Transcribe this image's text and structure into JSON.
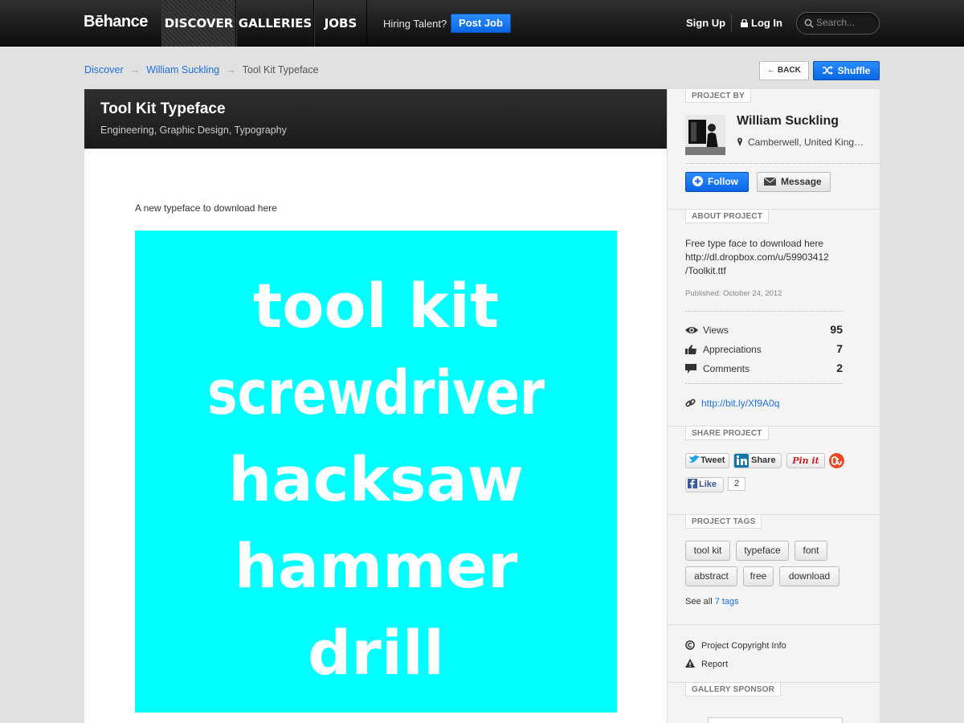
{
  "nav": {
    "logo": "Bēhance",
    "tabs": [
      "DISCOVER",
      "GALLERIES",
      "JOBS"
    ],
    "hiring_label": "Hiring Talent?",
    "post_job_label": "Post Job",
    "signup_label": "Sign Up",
    "login_label": "Log In",
    "search_placeholder": "Search..."
  },
  "breadcrumb": {
    "items": [
      "Discover",
      "William Suckling",
      "Tool Kit Typeface"
    ],
    "separator": "→"
  },
  "actions": {
    "back_label": "← BACK",
    "shuffle_label": "Shuffle"
  },
  "project": {
    "title": "Tool Kit Typeface",
    "fields": "Engineering, Graphic Design, Typography",
    "intro": "A new typeface to download here",
    "artwork_words": [
      "tool kit",
      "screwdriver",
      "hacksaw",
      "hammer",
      "drill"
    ],
    "artwork_bg": "#00ffff"
  },
  "sidebar": {
    "project_by_label": "PROJECT BY",
    "owner_name": "William Suckling",
    "owner_location": "Camberwell, United King…",
    "follow_label": "Follow",
    "message_label": "Message",
    "about_label": "ABOUT PROJECT",
    "about_lines": [
      "Free type face to download here",
      "http://dl.dropbox.com/u/59903412",
      "/Toolkit.ttf"
    ],
    "published": "Published: October 24, 2012",
    "stats": [
      {
        "label": "Views",
        "value": "95",
        "icon": "eye-icon"
      },
      {
        "label": "Appreciations",
        "value": "7",
        "icon": "thumbs-up-icon"
      },
      {
        "label": "Comments",
        "value": "2",
        "icon": "comment-icon"
      }
    ],
    "short_link": "http://bit.ly/Xf9A0q",
    "share_label": "SHARE PROJECT",
    "tweet_label": "Tweet",
    "linkedin_label": "Share",
    "pinit_label": "Pin it",
    "like_label": "Like",
    "like_count": "2",
    "tags_label": "PROJECT TAGS",
    "tags": [
      "tool kit",
      "typeface",
      "font",
      "abstract",
      "free",
      "download"
    ],
    "see_all_prefix": "See all",
    "see_all_link": "7 tags",
    "copyright_label": "Project Copyright Info",
    "report_label": "Report",
    "sponsor_label": "GALLERY SPONSOR"
  }
}
